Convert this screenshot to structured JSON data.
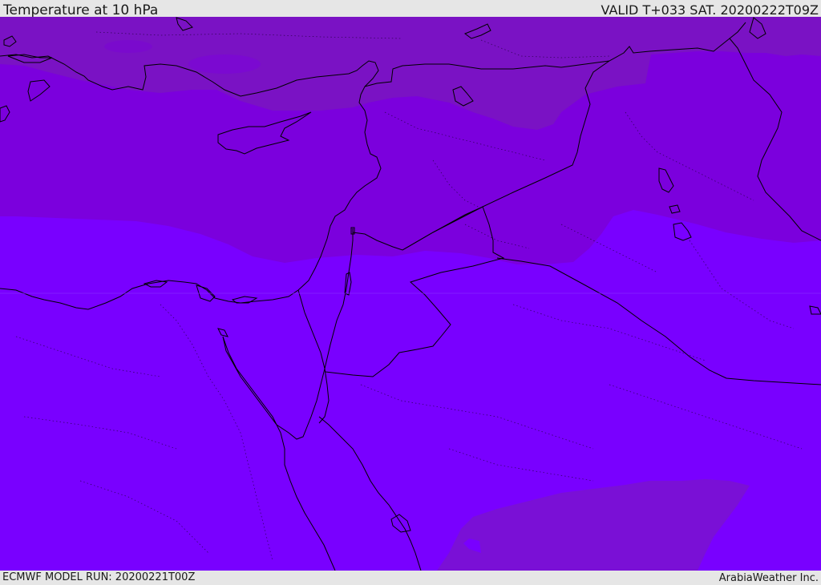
{
  "header": {
    "title": "Temperature at 10 hPa",
    "valid": "VALID T+033 SAT. 20200222T09Z"
  },
  "footer": {
    "model_run": "ECMWF MODEL RUN: 20200221T00Z",
    "credit": "ArabiaWeather Inc."
  },
  "colors": {
    "band_warm": "#7a12c4",
    "band_mid": "#7b00dd",
    "band_cold": "#7900ff",
    "coastline": "#000000",
    "background": "#e6e6e6"
  }
}
